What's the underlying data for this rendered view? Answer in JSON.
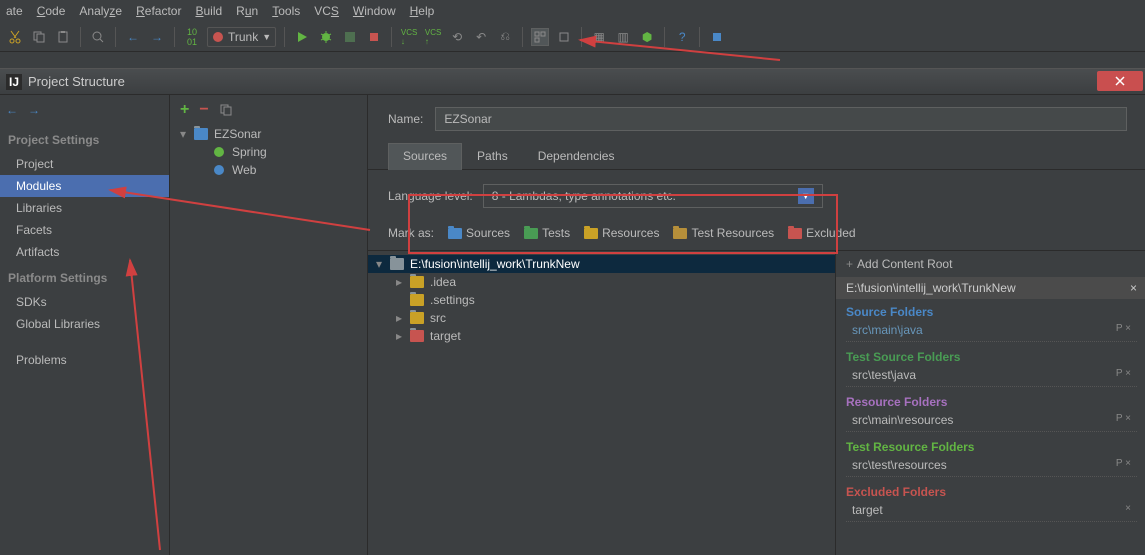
{
  "menubar": [
    "ate",
    "Code",
    "Analyze",
    "Refactor",
    "Build",
    "Run",
    "Tools",
    "VCS",
    "Window",
    "Help"
  ],
  "toolbar": {
    "trunk_label": "Trunk"
  },
  "dialog": {
    "title": "Project Structure",
    "left_nav": {
      "back_fwd": true,
      "section1": "Project Settings",
      "items1": [
        "Project",
        "Modules",
        "Libraries",
        "Facets",
        "Artifacts"
      ],
      "section2": "Platform Settings",
      "items2": [
        "SDKs",
        "Global Libraries"
      ],
      "problems": "Problems"
    },
    "mid_tree": {
      "root": "EZSonar",
      "children": [
        "Spring",
        "Web"
      ]
    },
    "right": {
      "name_label": "Name:",
      "name_value": "EZSonar",
      "tabs": [
        "Sources",
        "Paths",
        "Dependencies"
      ],
      "lang_label": "Language level:",
      "lang_value": "8 - Lambdas, type annotations etc.",
      "mark_label": "Mark as:",
      "mark_buttons": [
        {
          "label": "Sources",
          "color": "#4a88c7"
        },
        {
          "label": "Tests",
          "color": "#499c54"
        },
        {
          "label": "Resources",
          "color": "#c9a126"
        },
        {
          "label": "Test Resources",
          "color": "#b68f3a"
        },
        {
          "label": "Excluded",
          "color": "#c75450"
        }
      ],
      "file_tree": {
        "root": "E:\\fusion\\intellij_work\\TrunkNew",
        "items": [
          {
            "name": ".idea",
            "color": "#c9a126"
          },
          {
            "name": ".settings",
            "color": "#c9a126"
          },
          {
            "name": "src",
            "color": "#c9a126"
          },
          {
            "name": "target",
            "color": "#c75450"
          }
        ]
      },
      "sidebar": {
        "add_root": "Add Content Root",
        "path": "E:\\fusion\\intellij_work\\TrunkNew",
        "sections": [
          {
            "title": "Source Folders",
            "color": "#4a88c7",
            "items": [
              "src\\main\\java"
            ]
          },
          {
            "title": "Test Source Folders",
            "color": "#499c54",
            "items": [
              "src\\test\\java"
            ]
          },
          {
            "title": "Resource Folders",
            "color": "#a771bf",
            "items": [
              "src\\main\\resources"
            ]
          },
          {
            "title": "Test Resource Folders",
            "color": "#62b543",
            "items": [
              "src\\test\\resources"
            ]
          },
          {
            "title": "Excluded Folders",
            "color": "#c75450",
            "items": [
              "target"
            ]
          }
        ]
      }
    }
  }
}
